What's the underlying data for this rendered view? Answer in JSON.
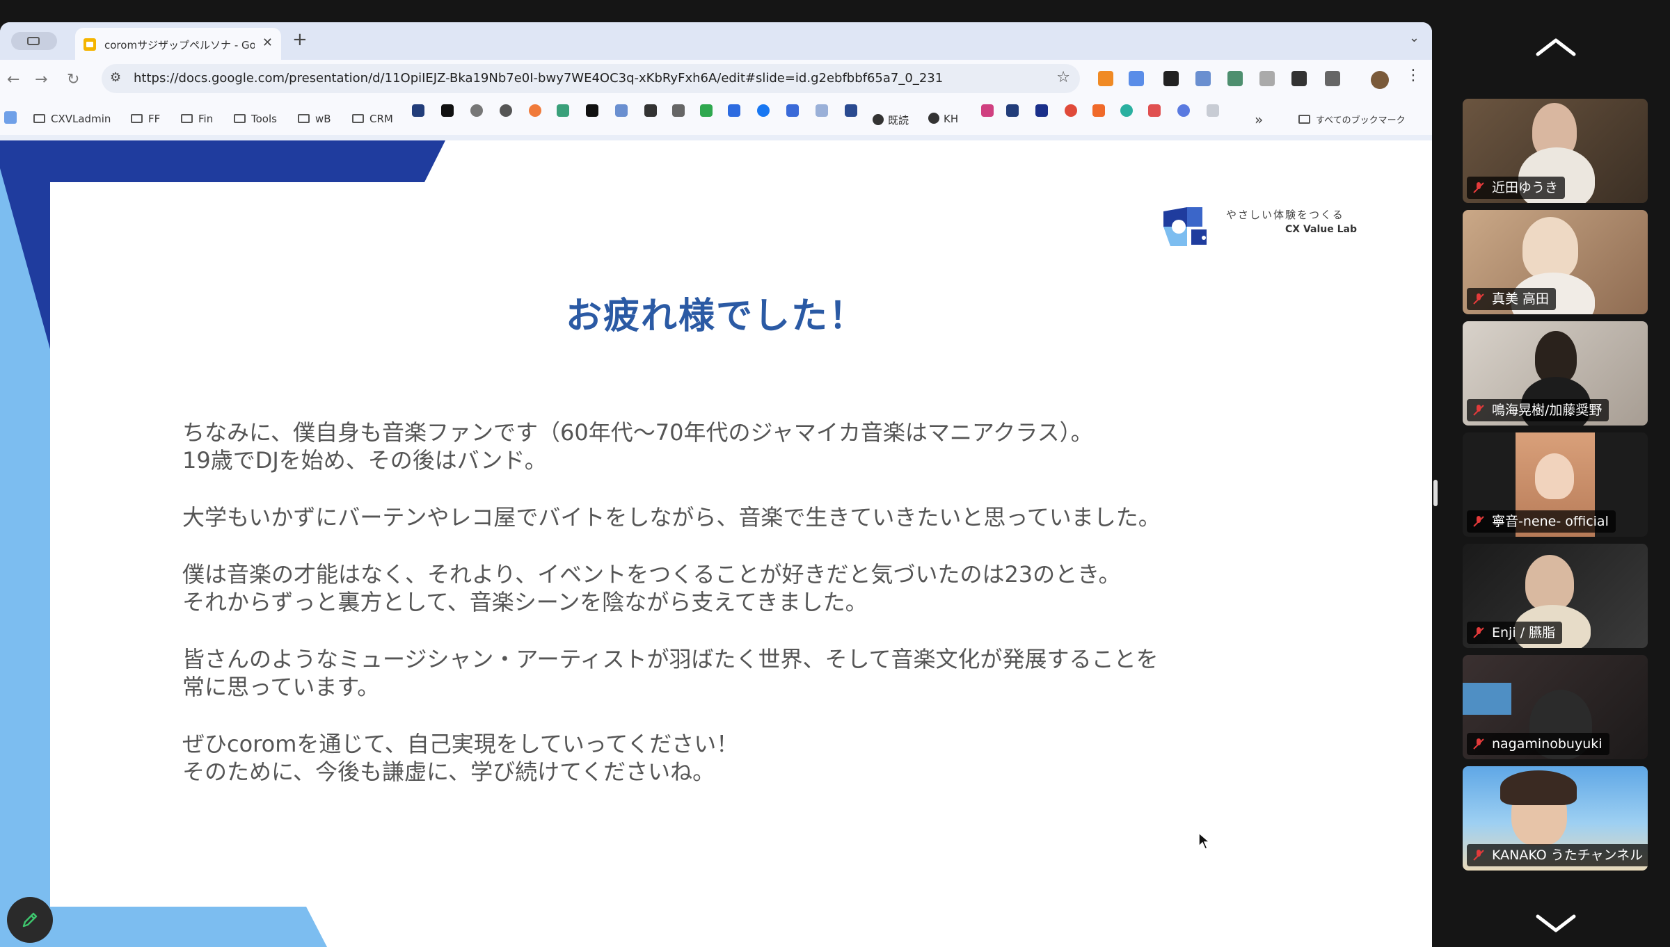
{
  "browser": {
    "tab_title": "coromサジザップペルソナ - Google スライド",
    "url": "https://docs.google.com/presentation/d/11OpiIEJZ-Bka19Nb7e0I-bwy7WE4OC3q-xKbRyFxh6A/edit#slide=id.g2ebfbbf65a7_0_231",
    "bookmarks": [
      "CXVLadmin",
      "FF",
      "Fin",
      "Tools",
      "wB",
      "CRM",
      "既読",
      "KH"
    ],
    "all_bookmarks_label": "すべてのブックマーク"
  },
  "slide": {
    "title": "お疲れ様でした！",
    "logo_tagline": "やさしい体験をつくる",
    "logo_name": "CX Value Lab",
    "paragraphs": [
      [
        "ちなみに、僕自身も音楽ファンです（60年代〜70年代のジャマイカ音楽はマニアクラス）。",
        "19歳でDJを始め、その後はバンド。"
      ],
      [
        "大学もいかずにバーテンやレコ屋でバイトをしながら、音楽で生きていきたいと思っていました。"
      ],
      [
        "僕は音楽の才能はなく、それより、イベントをつくることが好きだと気づいたのは23のとき。",
        "それからずっと裏方として、音楽シーンを陰ながら支えてきました。"
      ],
      [
        "皆さんのようなミュージシャン・アーティストが羽ばたく世界、そして音楽文化が発展することを",
        "常に思っています。"
      ],
      [
        "ぜひcoromを通じて、自己実現をしていってください！",
        "そのために、今後も謙虚に、学び続けてくださいね。"
      ]
    ]
  },
  "participants": [
    {
      "name": "近田ゆうき",
      "muted": true
    },
    {
      "name": "真美 高田",
      "muted": true
    },
    {
      "name": "鳴海晃樹/加藤奨野",
      "muted": true
    },
    {
      "name": "寧音-nene- official",
      "muted": true
    },
    {
      "name": "Enji / 臙脂",
      "muted": true
    },
    {
      "name": "nagaminobuyuki",
      "muted": true
    },
    {
      "name": "KANAKO うたチャンネル",
      "muted": true
    }
  ],
  "colors": {
    "title_blue": "#2b5aa4",
    "deco_navy": "#1f3c9e",
    "deco_light": "#7cbdf0",
    "muted_red": "#e33a3a"
  }
}
